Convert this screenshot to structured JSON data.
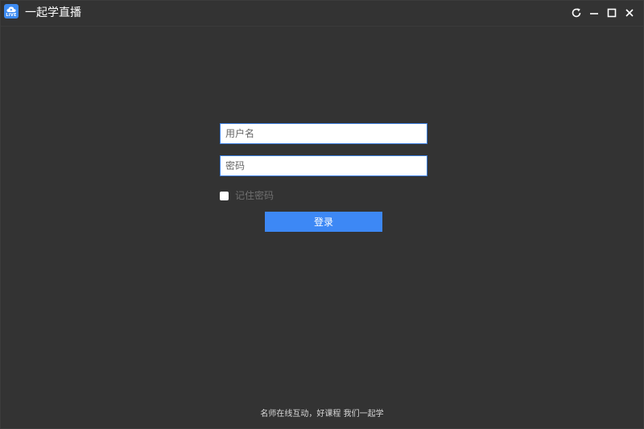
{
  "app": {
    "title": "一起学直播",
    "logo_text": "LIVE",
    "accent_color": "#3d88f5"
  },
  "window_controls": {
    "refresh_icon": "refresh-icon",
    "minimize_icon": "minimize-icon",
    "maximize_icon": "maximize-icon",
    "close_icon": "close-icon"
  },
  "login": {
    "username_placeholder": "用户名",
    "username_value": "",
    "password_placeholder": "密码",
    "password_value": "",
    "remember_label": "记住密码",
    "remember_checked": false,
    "submit_label": "登录"
  },
  "footer": {
    "slogan": "名师在线互动，好课程 我们一起学"
  }
}
